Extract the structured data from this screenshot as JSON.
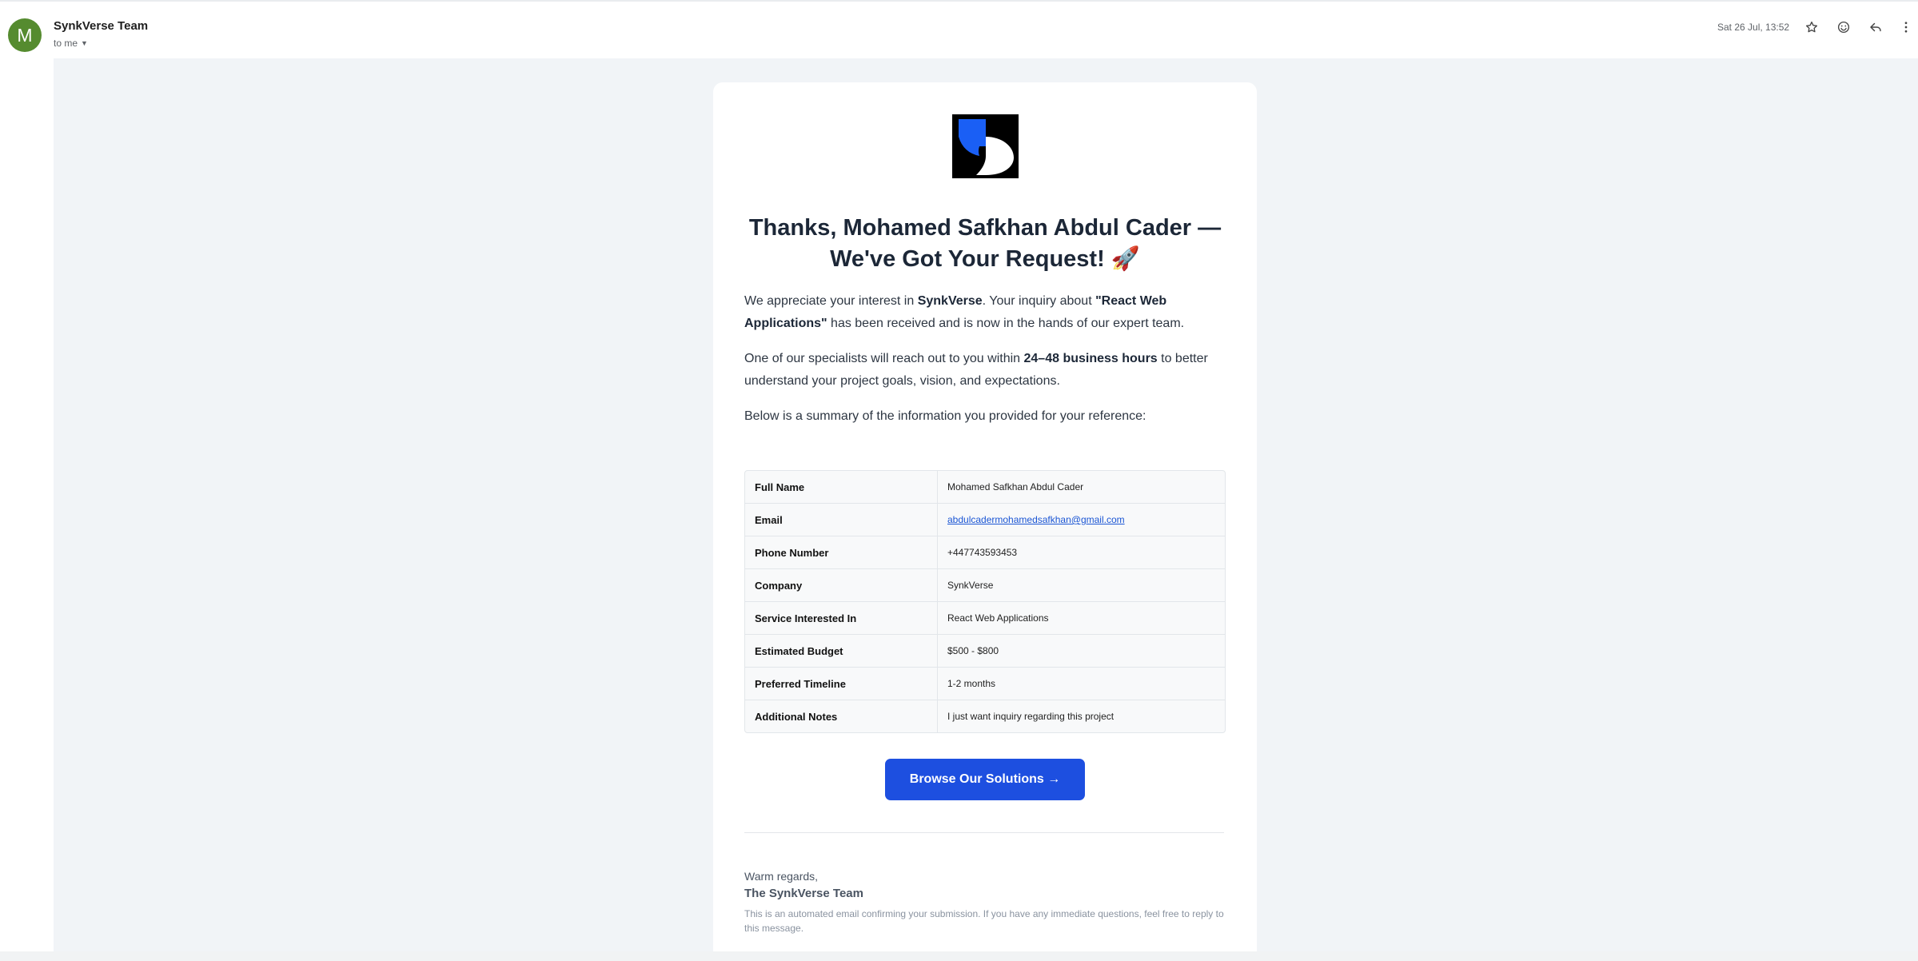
{
  "header": {
    "avatar_letter": "M",
    "avatar_color": "#558b2f",
    "sender": "SynkVerse Team",
    "recipient": "to me",
    "datetime": "Sat 26 Jul, 13:52",
    "icons": [
      "star-icon",
      "emoji-icon",
      "reply-icon",
      "more-vert-icon"
    ]
  },
  "email": {
    "headline": "Thanks, Mohamed Safkhan Abdul Cader — We've Got Your Request! 🚀",
    "p1": {
      "a": "We appreciate your interest in ",
      "brand": "SynkVerse",
      "b": ". Your inquiry about ",
      "service": "\"React Web Applications\"",
      "c": " has been received and is now in the hands of our expert team."
    },
    "p2": {
      "a": "One of our specialists will reach out to you within ",
      "hours": "24–48 business hours",
      "b": " to better understand your project goals, vision, and expectations."
    },
    "p3": "Below is a summary of the information you provided for your reference:",
    "summary": [
      {
        "label": "Full Name",
        "value": "Mohamed Safkhan Abdul Cader"
      },
      {
        "label": "Email",
        "value": "abdulcadermohamedsafkhan@gmail.com"
      },
      {
        "label": "Phone Number",
        "value": "+447743593453"
      },
      {
        "label": "Company",
        "value": "SynkVerse"
      },
      {
        "label": "Service Interested In",
        "value": "React Web Applications"
      },
      {
        "label": "Estimated Budget",
        "value": "$500 - $800"
      },
      {
        "label": "Preferred Timeline",
        "value": "1-2 months"
      },
      {
        "label": "Additional Notes",
        "value": "I just want inquiry regarding this project"
      }
    ],
    "cta": "Browse Our Solutions →",
    "signoff": "Warm regards,",
    "team": "The SynkVerse Team",
    "footnote": "This is an automated email confirming your submission. If you have any immediate questions, feel free to reply to this message.",
    "accent_color": "#1d4fe0"
  }
}
